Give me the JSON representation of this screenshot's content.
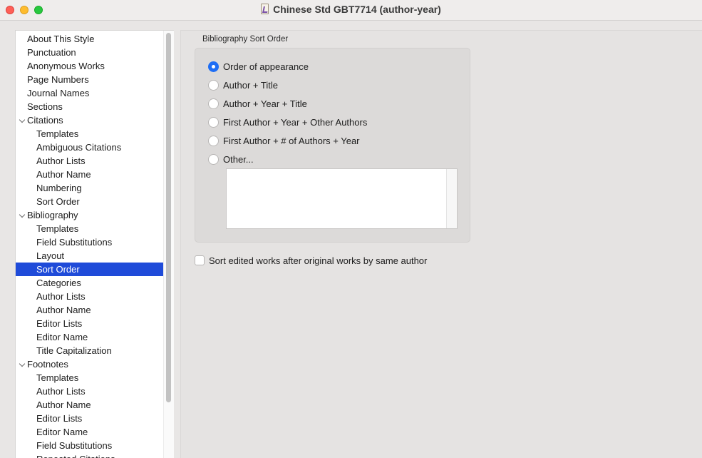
{
  "window": {
    "title": "Chinese Std GBT7714 (author-year)",
    "doc_icon": "style-document-icon"
  },
  "sidebar": {
    "items": [
      {
        "label": "About This Style",
        "level": 0
      },
      {
        "label": "Punctuation",
        "level": 0
      },
      {
        "label": "Anonymous Works",
        "level": 0
      },
      {
        "label": "Page Numbers",
        "level": 0
      },
      {
        "label": "Journal Names",
        "level": 0
      },
      {
        "label": "Sections",
        "level": 0
      },
      {
        "label": "Citations",
        "level": 0,
        "expanded": true
      },
      {
        "label": "Templates",
        "level": 1
      },
      {
        "label": "Ambiguous Citations",
        "level": 1
      },
      {
        "label": "Author Lists",
        "level": 1
      },
      {
        "label": "Author Name",
        "level": 1
      },
      {
        "label": "Numbering",
        "level": 1
      },
      {
        "label": "Sort Order",
        "level": 1
      },
      {
        "label": "Bibliography",
        "level": 0,
        "expanded": true
      },
      {
        "label": "Templates",
        "level": 1
      },
      {
        "label": "Field Substitutions",
        "level": 1
      },
      {
        "label": "Layout",
        "level": 1
      },
      {
        "label": "Sort Order",
        "level": 1,
        "selected": true
      },
      {
        "label": "Categories",
        "level": 1
      },
      {
        "label": "Author Lists",
        "level": 1
      },
      {
        "label": "Author Name",
        "level": 1
      },
      {
        "label": "Editor Lists",
        "level": 1
      },
      {
        "label": "Editor Name",
        "level": 1
      },
      {
        "label": "Title Capitalization",
        "level": 1
      },
      {
        "label": "Footnotes",
        "level": 0,
        "expanded": true
      },
      {
        "label": "Templates",
        "level": 1
      },
      {
        "label": "Author Lists",
        "level": 1
      },
      {
        "label": "Author Name",
        "level": 1
      },
      {
        "label": "Editor Lists",
        "level": 1
      },
      {
        "label": "Editor Name",
        "level": 1
      },
      {
        "label": "Field Substitutions",
        "level": 1
      },
      {
        "label": "Repeated Citations",
        "level": 1
      }
    ]
  },
  "sort_order": {
    "group_label": "Bibliography Sort Order",
    "options": [
      {
        "label": "Order of appearance",
        "checked": true
      },
      {
        "label": "Author + Title",
        "checked": false
      },
      {
        "label": "Author + Year + Title",
        "checked": false
      },
      {
        "label": "First Author + Year + Other Authors",
        "checked": false
      },
      {
        "label": "First Author + # of Authors + Year",
        "checked": false
      },
      {
        "label": "Other...",
        "checked": false
      }
    ],
    "other_value": "",
    "edited_works_checkbox": {
      "label": "Sort edited works after original works by same author",
      "checked": false
    }
  },
  "colors": {
    "selection": "#1f4bd9",
    "radio_checked": "#1f6ef5"
  }
}
